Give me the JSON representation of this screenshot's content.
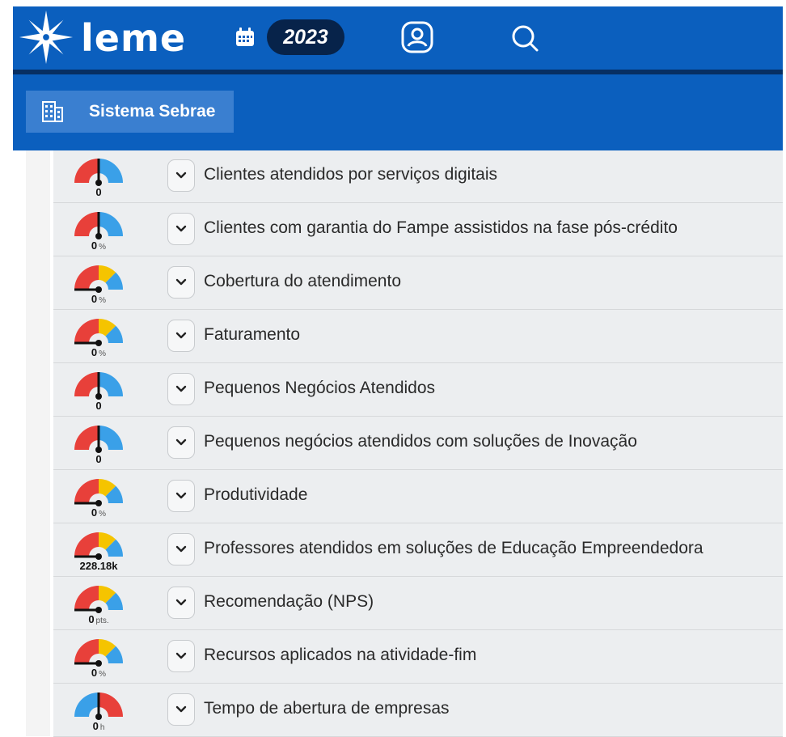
{
  "header": {
    "brand": "leme",
    "year": "2023",
    "icons": [
      "compass-star-icon",
      "calendar-icon",
      "user-icon",
      "search-icon"
    ]
  },
  "org": {
    "name": "Sistema Sebrae",
    "icon": "building-icon"
  },
  "colors": {
    "header_bg": "#0b5fbe",
    "header_line": "#072f63",
    "chip_bg": "#3a7fd0",
    "gauge_red": "#e8403a",
    "gauge_blue": "#3aa0e8",
    "gauge_yellow": "#f5c400"
  },
  "indicators": [
    {
      "label": "Clientes atendidos por serviços digitais",
      "value": "0",
      "unit": "",
      "gauge": "red-blue",
      "needle_position": 0.5
    },
    {
      "label": "Clientes com garantia do Fampe assistidos na fase pós-crédito",
      "value": "0",
      "unit": "%",
      "gauge": "red-blue",
      "needle_position": 0.5
    },
    {
      "label": "Cobertura do atendimento",
      "value": "0",
      "unit": "%",
      "gauge": "red-yellow-blue",
      "needle_position": 0
    },
    {
      "label": "Faturamento",
      "value": "0",
      "unit": "%",
      "gauge": "red-yellow-blue",
      "needle_position": 0
    },
    {
      "label": "Pequenos Negócios Atendidos",
      "value": "0",
      "unit": "",
      "gauge": "red-blue",
      "needle_position": 0.5
    },
    {
      "label": "Pequenos negócios atendidos com soluções de Inovação",
      "value": "0",
      "unit": "",
      "gauge": "red-blue",
      "needle_position": 0.5
    },
    {
      "label": "Produtividade",
      "value": "0",
      "unit": "%",
      "gauge": "red-yellow-blue",
      "needle_position": 0
    },
    {
      "label": "Professores atendidos em soluções de Educação Empreendedora",
      "value": "228.18k",
      "unit": "",
      "gauge": "red-yellow-blue",
      "needle_position": 0
    },
    {
      "label": "Recomendação (NPS)",
      "value": "0",
      "unit": "pts.",
      "gauge": "red-yellow-blue",
      "needle_position": 0
    },
    {
      "label": "Recursos aplicados na atividade-fim",
      "value": "0",
      "unit": "%",
      "gauge": "red-yellow-blue",
      "needle_position": 0
    },
    {
      "label": "Tempo de abertura de empresas",
      "value": "0",
      "unit": "h",
      "gauge": "blue-red",
      "needle_position": 0.5
    }
  ]
}
